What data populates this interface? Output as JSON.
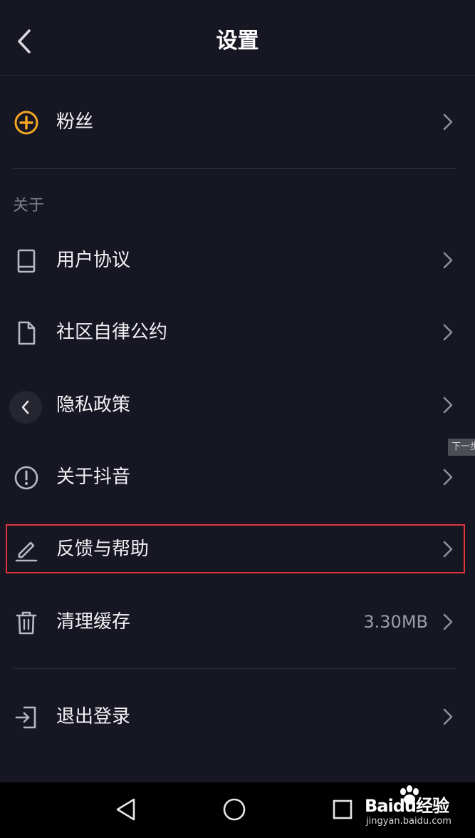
{
  "header": {
    "title": "设置"
  },
  "rows": [
    {
      "label": "粉丝",
      "icon": "plus-circle-icon"
    },
    {
      "label": "用户协议",
      "icon": "book-icon"
    },
    {
      "label": "社区自律公约",
      "icon": "document-icon"
    },
    {
      "label": "隐私政策",
      "icon": "privacy-lock-icon"
    },
    {
      "label": "关于抖音",
      "icon": "info-exclamation-icon"
    },
    {
      "label": "反馈与帮助",
      "icon": "edit-pencil-icon"
    },
    {
      "label": "清理缓存",
      "icon": "trash-icon",
      "value": "3.30MB"
    },
    {
      "label": "退出登录",
      "icon": "logout-icon"
    }
  ],
  "section": {
    "about_label": "关于"
  },
  "side_tag": {
    "text": "下一步"
  },
  "navbar": {
    "icons": [
      "nav-back-icon",
      "nav-home-icon",
      "nav-recent-icon"
    ]
  },
  "watermark": {
    "main": "Baidu经验",
    "sub": "jingyan.baidu.com"
  },
  "colors": {
    "background": "#161722",
    "accent_orange": "#f5a623",
    "highlight_red": "#e0343a",
    "muted_text": "#7d7e88"
  }
}
